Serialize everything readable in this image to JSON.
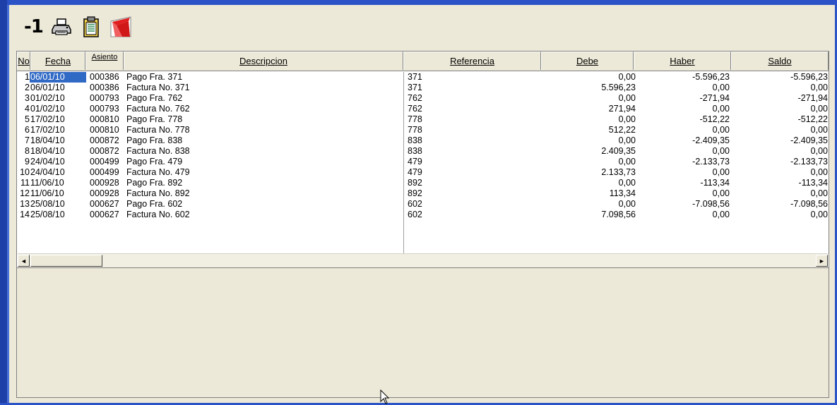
{
  "toolbar": {
    "minus_label": "-1",
    "buttons": [
      {
        "icon": "printer-icon"
      },
      {
        "icon": "clipboard-icon"
      },
      {
        "icon": "pdf-icon"
      }
    ]
  },
  "grid": {
    "headers": {
      "no": "No",
      "fecha": "Fecha",
      "asiento": "Asiento",
      "descripcion": "Descripcion",
      "referencia": "Referencia",
      "debe": "Debe",
      "haber": "Haber",
      "saldo": "Saldo"
    },
    "rows": [
      {
        "no": "1",
        "fecha": "06/01/10",
        "asiento": "000386",
        "desc": "Pago Fra. 371",
        "ref": "371",
        "debe": "0,00",
        "haber": "-5.596,23",
        "saldo": "-5.596,23"
      },
      {
        "no": "2",
        "fecha": "06/01/10",
        "asiento": "000386",
        "desc": "Factura No.  371",
        "ref": "371",
        "debe": "5.596,23",
        "haber": "0,00",
        "saldo": "0,00"
      },
      {
        "no": "3",
        "fecha": "01/02/10",
        "asiento": "000793",
        "desc": "Pago Fra. 762",
        "ref": "762",
        "debe": "0,00",
        "haber": "-271,94",
        "saldo": "-271,94"
      },
      {
        "no": "4",
        "fecha": "01/02/10",
        "asiento": "000793",
        "desc": "Factura No.  762",
        "ref": "762",
        "debe": "271,94",
        "haber": "0,00",
        "saldo": "0,00"
      },
      {
        "no": "5",
        "fecha": "17/02/10",
        "asiento": "000810",
        "desc": "Pago Fra. 778",
        "ref": "778",
        "debe": "0,00",
        "haber": "-512,22",
        "saldo": "-512,22"
      },
      {
        "no": "6",
        "fecha": "17/02/10",
        "asiento": "000810",
        "desc": "Factura No.  778",
        "ref": "778",
        "debe": "512,22",
        "haber": "0,00",
        "saldo": "0,00"
      },
      {
        "no": "7",
        "fecha": "18/04/10",
        "asiento": "000872",
        "desc": "Pago Fra. 838",
        "ref": "838",
        "debe": "0,00",
        "haber": "-2.409,35",
        "saldo": "-2.409,35"
      },
      {
        "no": "8",
        "fecha": "18/04/10",
        "asiento": "000872",
        "desc": "Factura No.  838",
        "ref": "838",
        "debe": "2.409,35",
        "haber": "0,00",
        "saldo": "0,00"
      },
      {
        "no": "9",
        "fecha": "24/04/10",
        "asiento": "000499",
        "desc": "Pago Fra. 479",
        "ref": "479",
        "debe": "0,00",
        "haber": "-2.133,73",
        "saldo": "-2.133,73"
      },
      {
        "no": "10",
        "fecha": "24/04/10",
        "asiento": "000499",
        "desc": "Factura No.  479",
        "ref": "479",
        "debe": "2.133,73",
        "haber": "0,00",
        "saldo": "0,00"
      },
      {
        "no": "11",
        "fecha": "11/06/10",
        "asiento": "000928",
        "desc": "Pago Fra. 892",
        "ref": "892",
        "debe": "0,00",
        "haber": "-113,34",
        "saldo": "-113,34"
      },
      {
        "no": "12",
        "fecha": "11/06/10",
        "asiento": "000928",
        "desc": "Factura No.  892",
        "ref": "892",
        "debe": "113,34",
        "haber": "0,00",
        "saldo": "0,00"
      },
      {
        "no": "13",
        "fecha": "25/08/10",
        "asiento": "000627",
        "desc": "Pago Fra. 602",
        "ref": "602",
        "debe": "0,00",
        "haber": "-7.098,56",
        "saldo": "-7.098,56"
      },
      {
        "no": "14",
        "fecha": "25/08/10",
        "asiento": "000627",
        "desc": "Factura No.  602",
        "ref": "602",
        "debe": "7.098,56",
        "haber": "0,00",
        "saldo": "0,00"
      }
    ],
    "selected_row": 0
  },
  "scrollbar": {
    "left_arrow": "◄",
    "right_arrow": "►"
  },
  "colors": {
    "frame": "#2B53C7",
    "selection": "#316AC5",
    "face": "#ECE9D8"
  }
}
